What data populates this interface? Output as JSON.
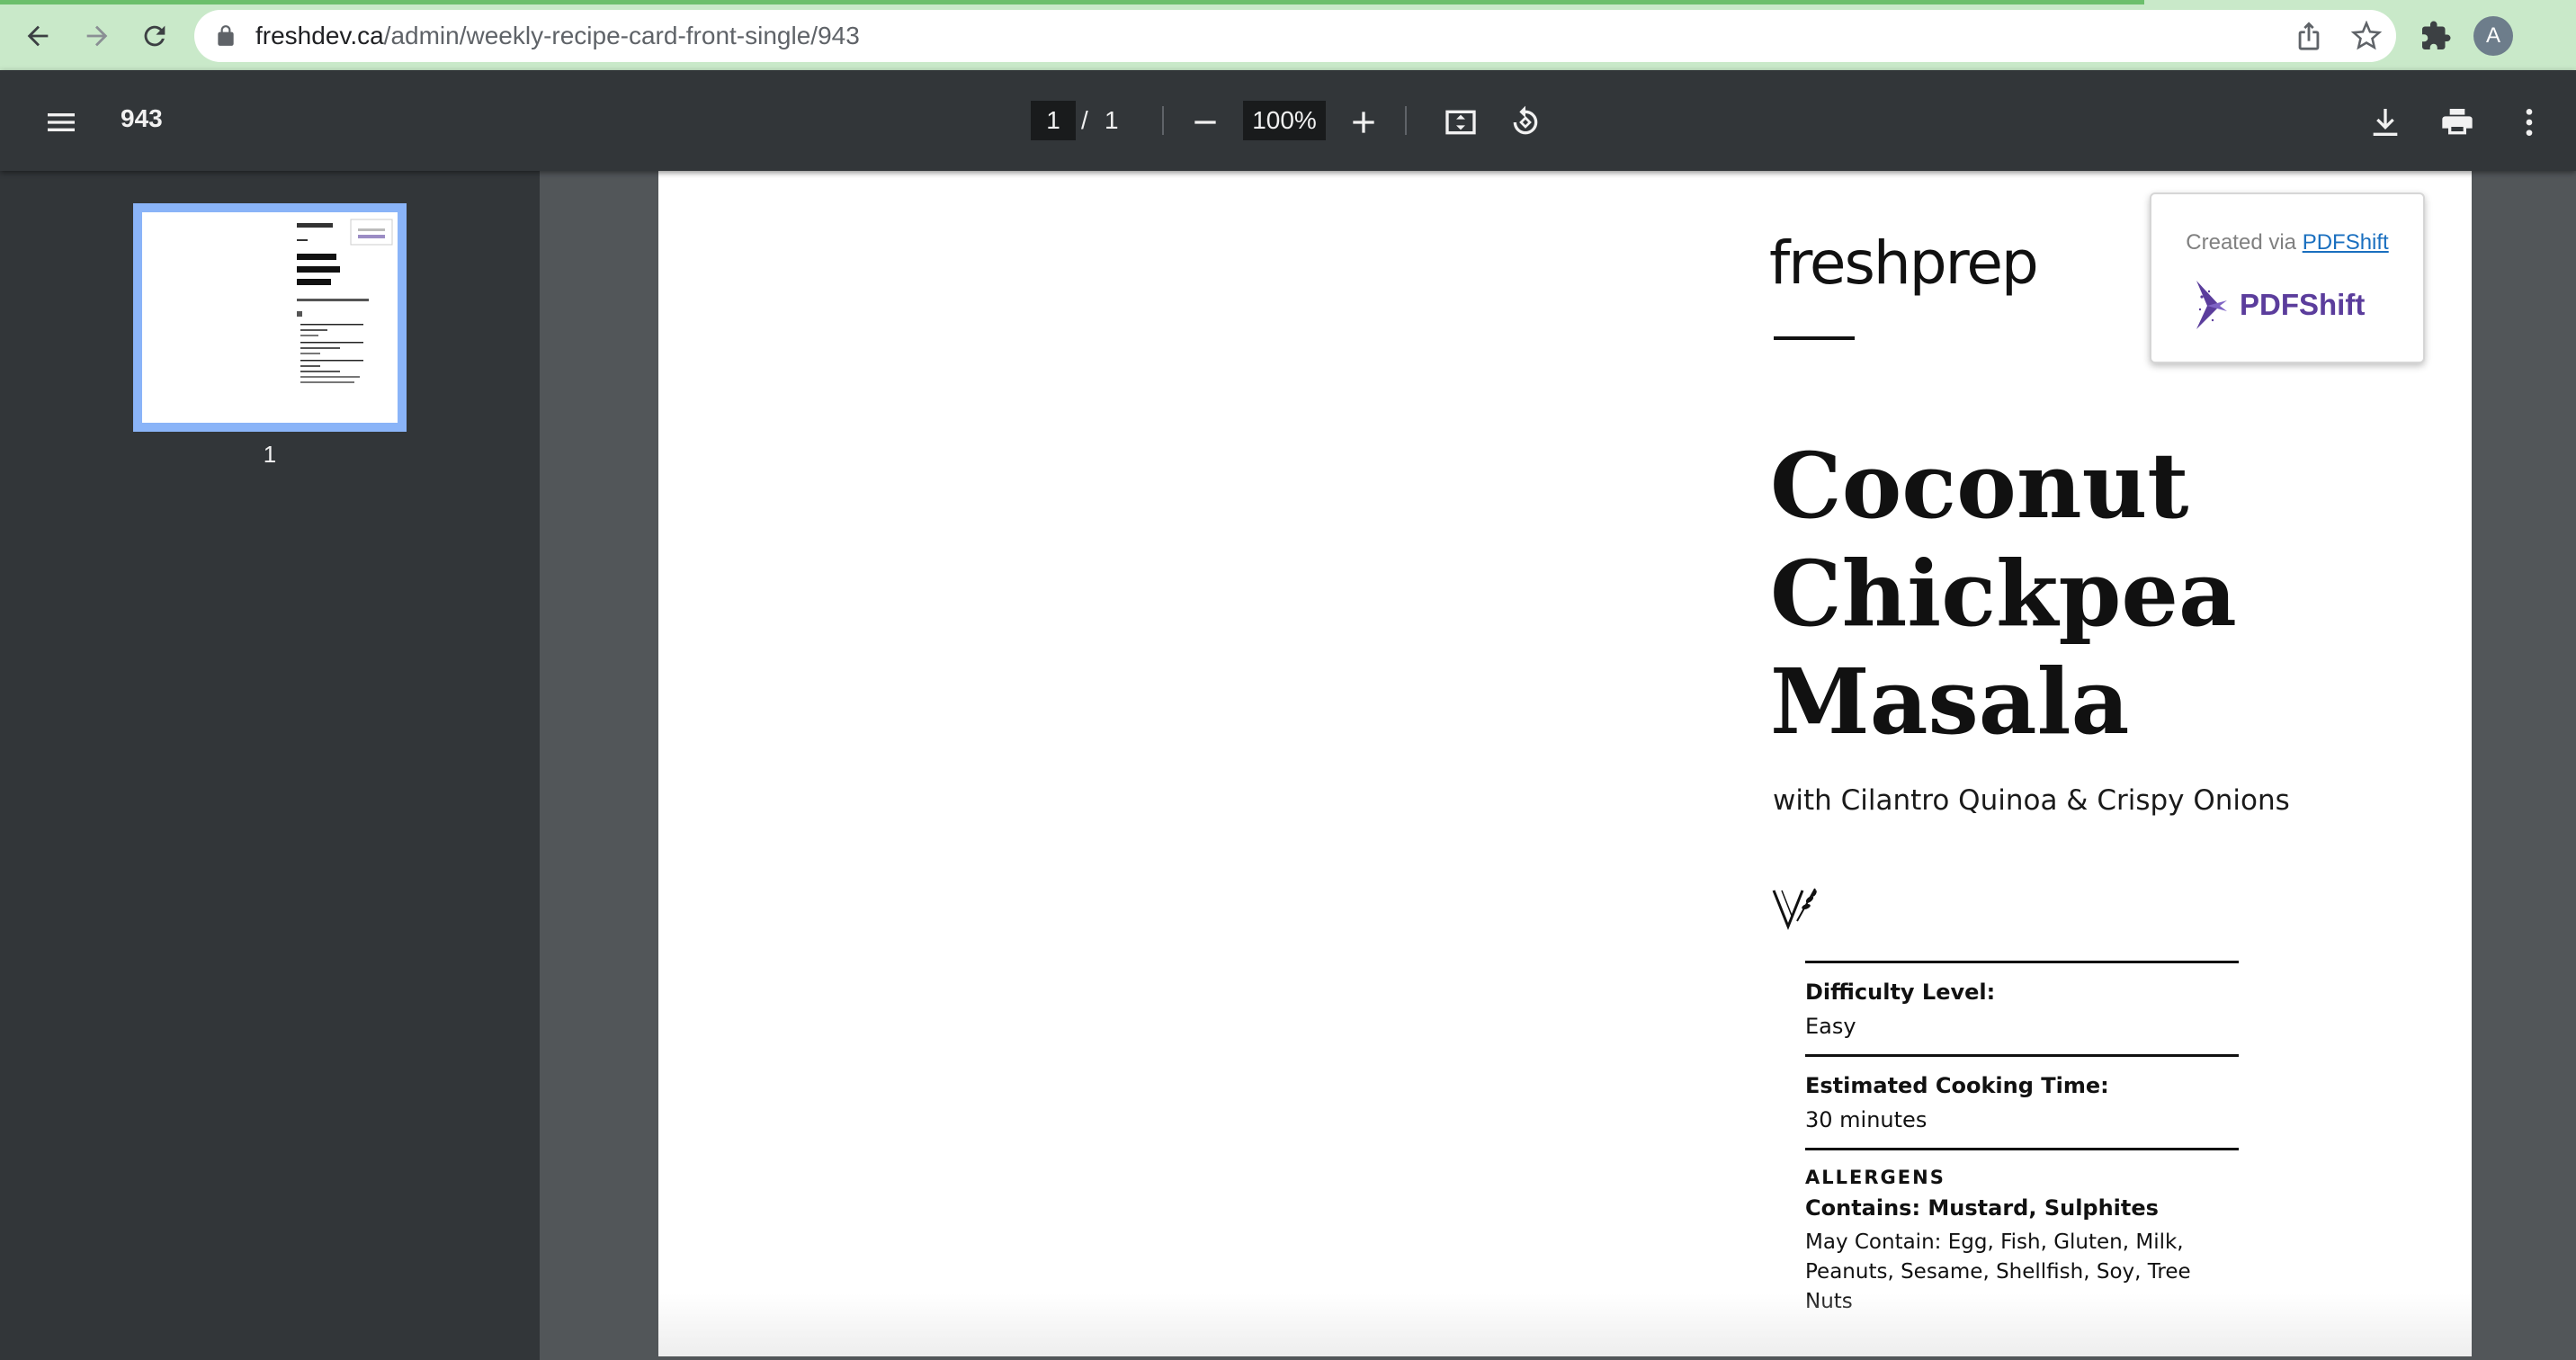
{
  "browser": {
    "url_host": "freshdev.ca",
    "url_path": "/admin/weekly-recipe-card-front-single/943",
    "avatar_letter": "A",
    "icons": [
      "back-arrow-icon",
      "forward-arrow-icon",
      "reload-icon",
      "lock-icon",
      "share-icon",
      "star-icon",
      "extensions-icon",
      "avatar"
    ]
  },
  "viewer": {
    "doc_title": "943",
    "current_page": "1",
    "page_separator": "/",
    "total_pages": "1",
    "zoom": "100%",
    "icons": [
      "menu-icon",
      "zoom-out-icon",
      "zoom-in-icon",
      "fit-page-icon",
      "rotate-icon",
      "download-icon",
      "print-icon",
      "more-vert-icon"
    ]
  },
  "sidebar": {
    "thumbnail_label": "1"
  },
  "page": {
    "brand": "freshprep",
    "title_lines": [
      "Coconut",
      "Chickpea",
      "Masala"
    ],
    "subtitle": "with Cilantro Quinoa & Crispy Onions",
    "diet_icon": "vegetarian-icon",
    "difficulty_label": "Difficulty Level:",
    "difficulty_value": "Easy",
    "time_label": "Estimated Cooking Time:",
    "time_value": "30 minutes",
    "allergens_heading": "ALLERGENS",
    "allergens_contains": "Contains: Mustard, Sulphites",
    "allergens_may_contain": "May Contain: Egg, Fish, Gluten, Milk, Peanuts, Sesame, Shellfish, Soy, Tree Nuts"
  },
  "watermark": {
    "created_via": "Created via",
    "link_text": "PDFShift",
    "logo_text": "PDFShift",
    "logo_color": "#5b3d9c"
  }
}
